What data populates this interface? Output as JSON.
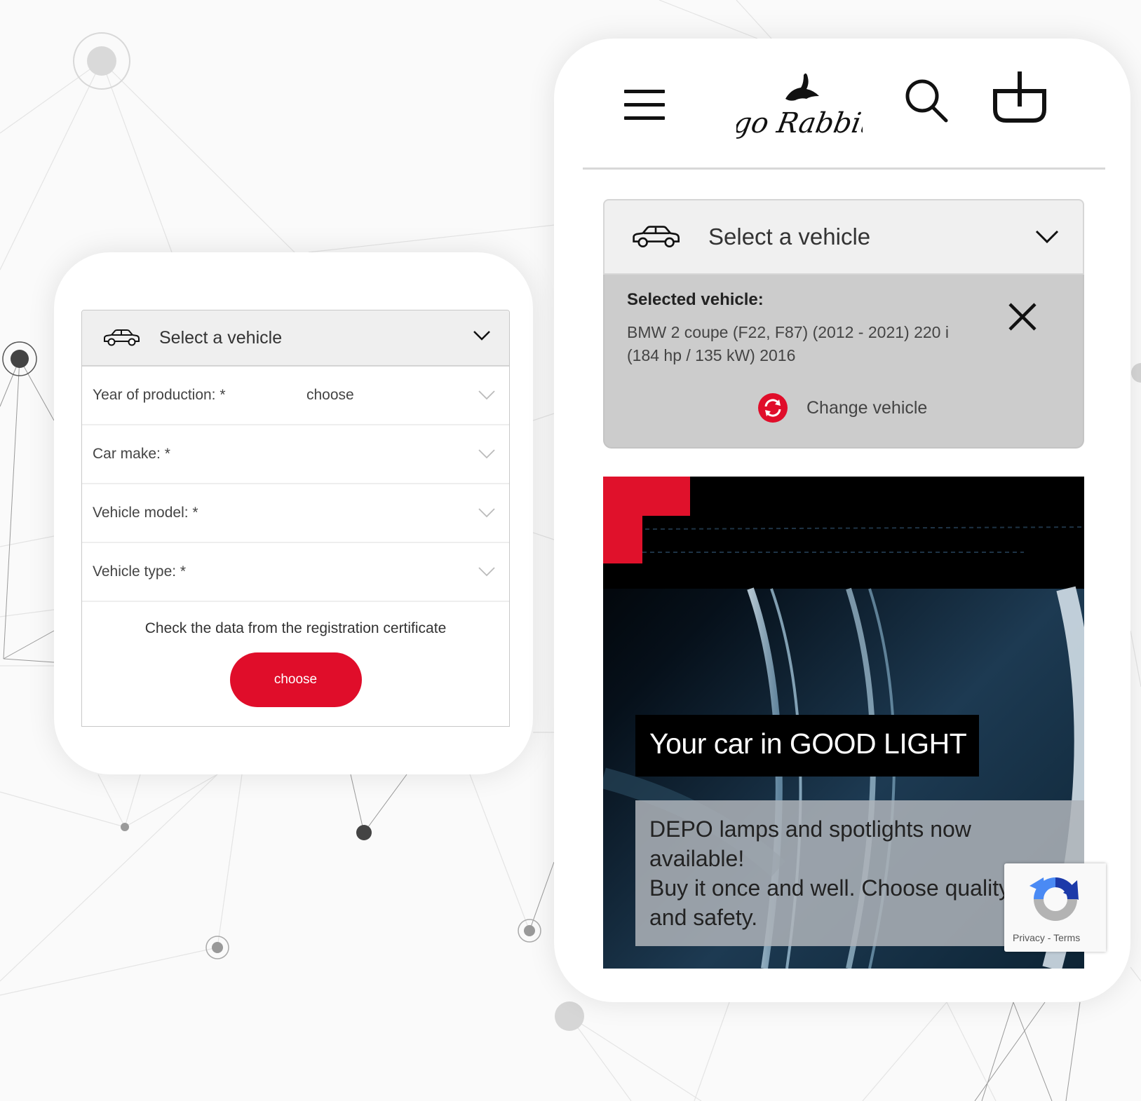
{
  "colors": {
    "accent_red": "#e00d2a",
    "recaptcha_blue": "#4285f4",
    "recaptcha_dark_blue": "#1c3aa9",
    "recaptcha_gray": "#b0b0b0"
  },
  "left_form": {
    "selector": {
      "icon": "car-icon",
      "label": "Select a vehicle",
      "toggle_icon": "chevron-down-icon"
    },
    "fields": [
      {
        "label": "Year of production: *",
        "value": "choose",
        "icon": "chevron-down-icon"
      },
      {
        "label": "Car make: *",
        "value": "",
        "icon": "chevron-down-icon"
      },
      {
        "label": "Vehicle model: *",
        "value": "",
        "icon": "chevron-down-icon"
      },
      {
        "label": "Vehicle type: *",
        "value": "",
        "icon": "chevron-down-icon"
      }
    ],
    "hint": "Check the data from the registration certificate",
    "button_label": "choose"
  },
  "right_app": {
    "header": {
      "menu_icon": "hamburger-menu-icon",
      "logo_text": "go Rabbit",
      "search_icon": "search-icon",
      "cart_icon": "cart-icon"
    },
    "selector": {
      "icon": "car-icon",
      "label": "Select a vehicle",
      "toggle_icon": "chevron-down-icon"
    },
    "selected": {
      "title": "Selected vehicle:",
      "description": "BMW 2 coupe (F22, F87) (2012 - 2021) 220 i (184 hp / 135 kW) 2016",
      "remove_icon": "close-icon",
      "change_icon": "refresh-icon",
      "change_label": "Change vehicle"
    },
    "banner": {
      "title": "Your car in GOOD LIGHT",
      "description_line1": "DEPO lamps and spotlights now available!",
      "description_line2": "Buy it once and well. Choose quality and safety."
    },
    "recaptcha": {
      "icon": "recaptcha-icon",
      "links": "Privacy - Terms"
    }
  }
}
